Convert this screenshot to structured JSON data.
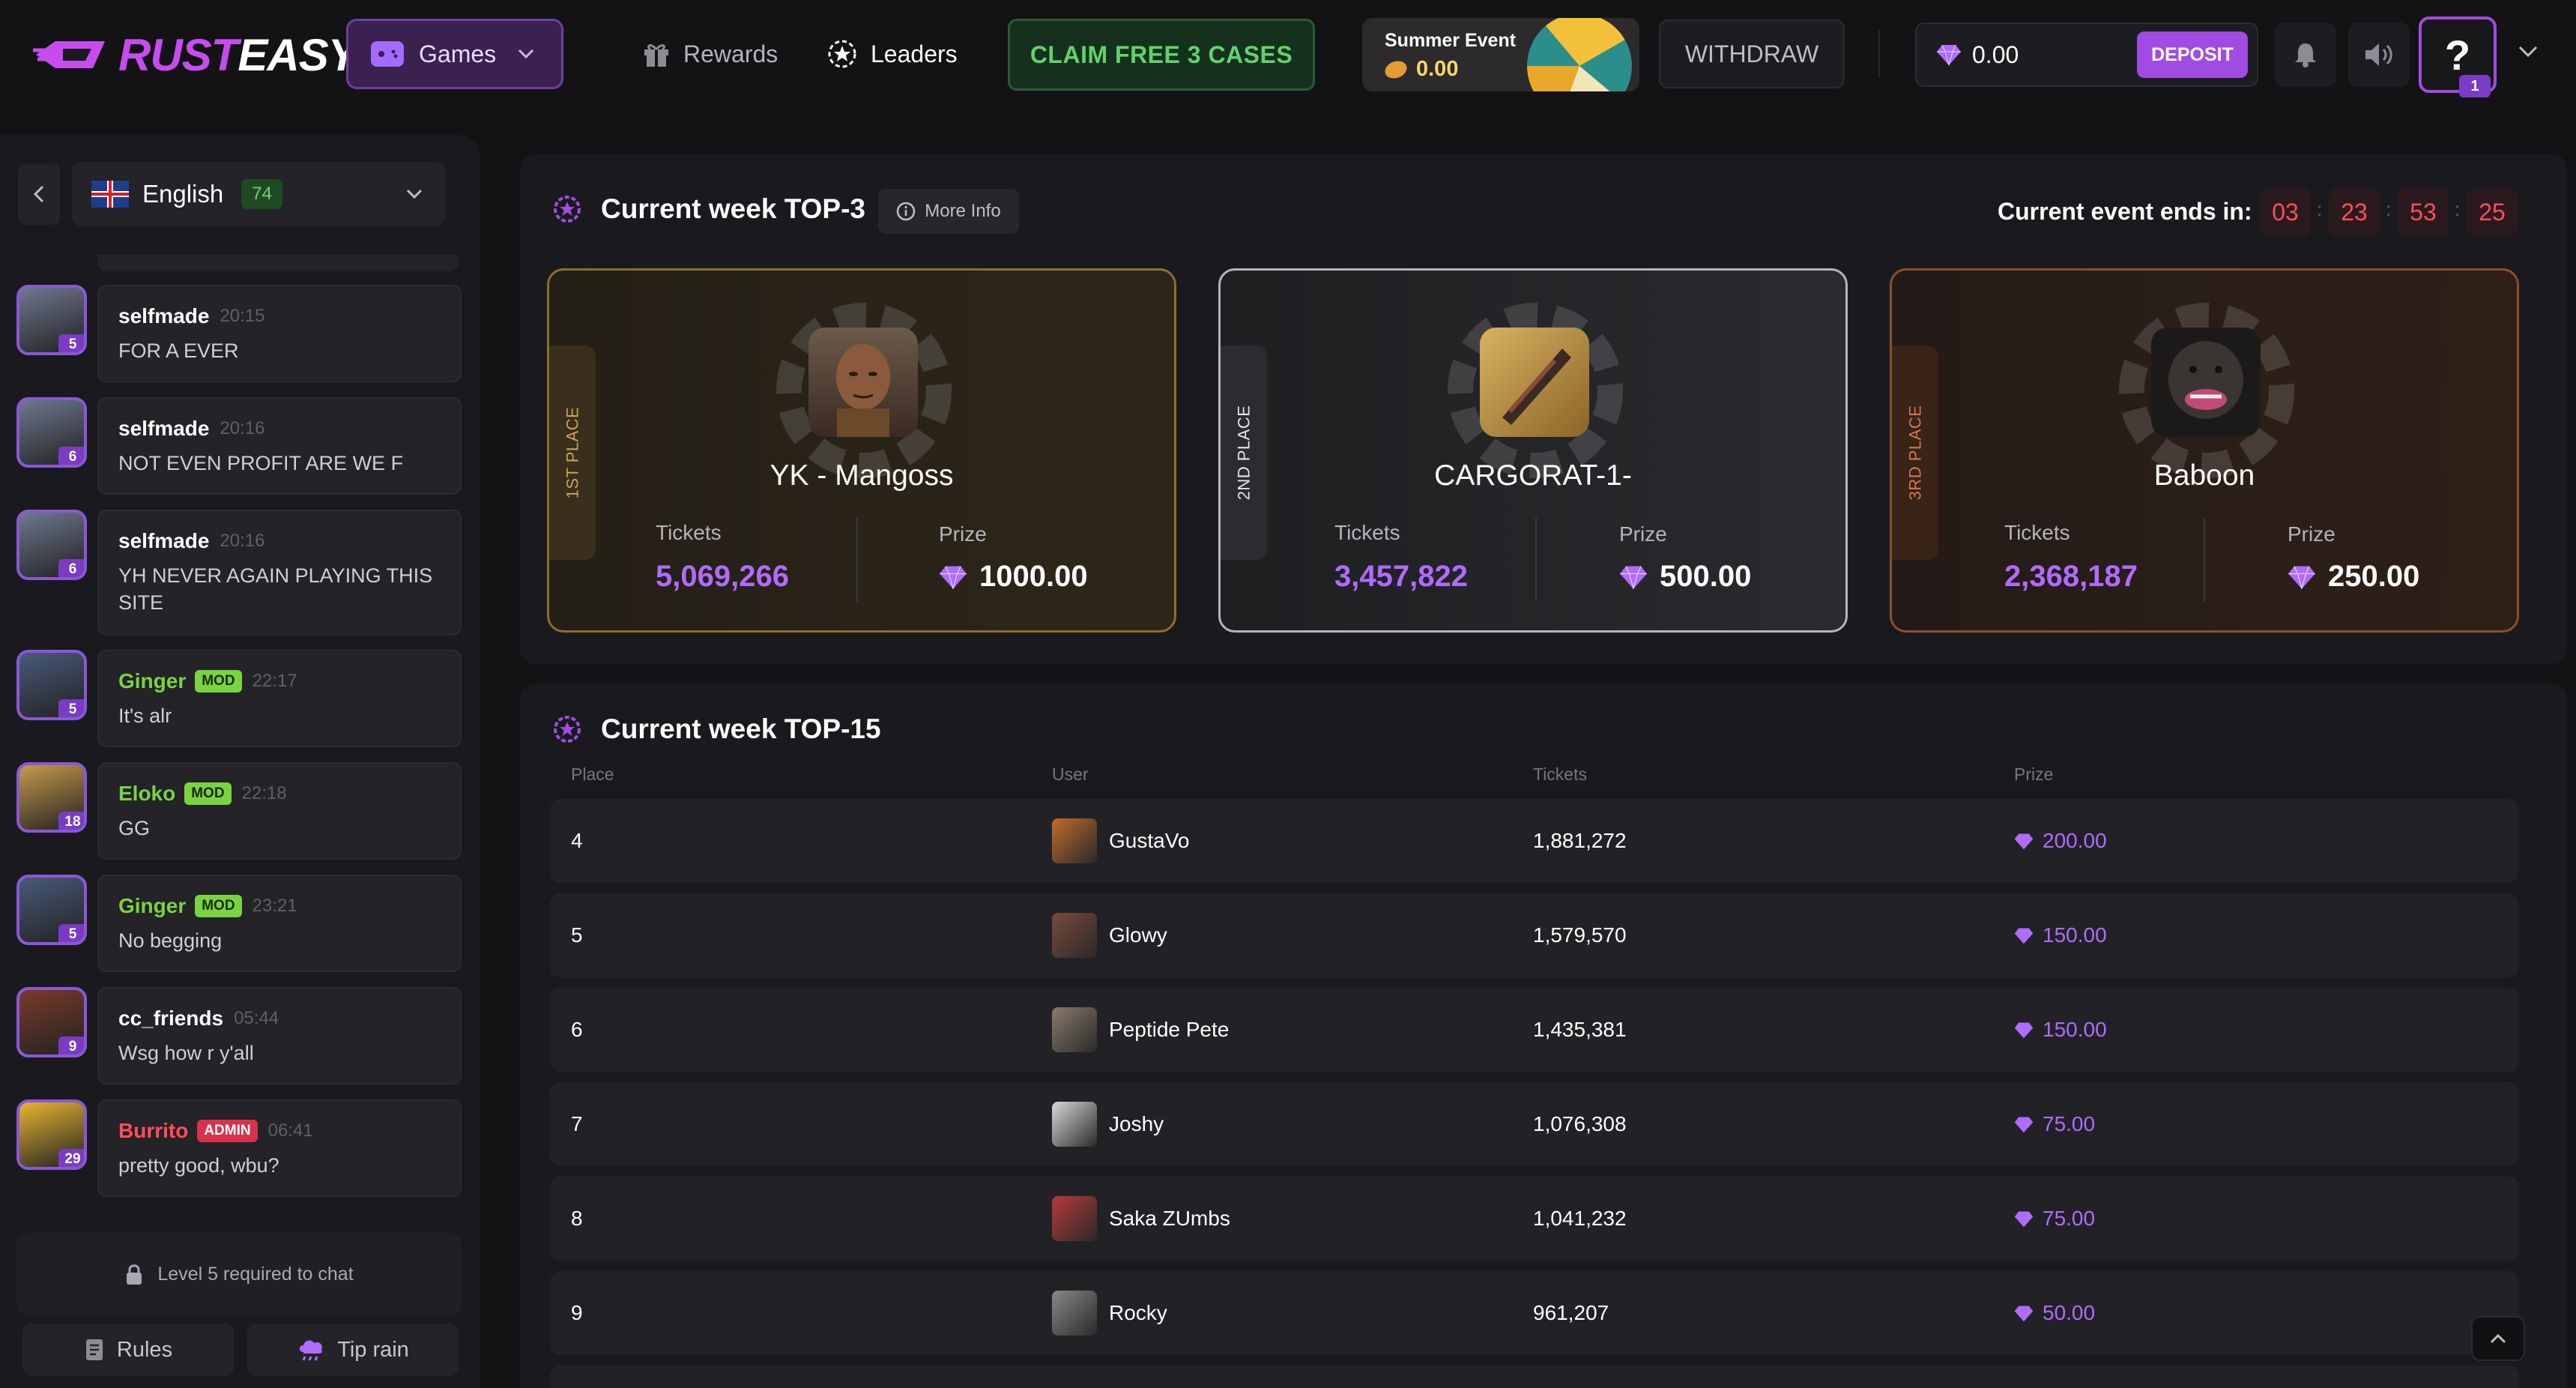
{
  "header": {
    "logo_part1": "RUST",
    "logo_part2": "EASY",
    "games_label": "Games",
    "nav": {
      "rewards": "Rewards",
      "leaders": "Leaders"
    },
    "claim_label": "CLAIM FREE 3 CASES",
    "event": {
      "title": "Summer Event",
      "value": "0.00"
    },
    "withdraw_label": "WITHDRAW",
    "balance": "0.00",
    "deposit_label": "DEPOSIT",
    "help_label": "?",
    "help_badge": "1"
  },
  "sidebar": {
    "language": "English",
    "online_count": "74",
    "messages": [
      {
        "user": "selfmade",
        "role": "",
        "time": "20:15",
        "text": "FOR A EVER",
        "level": "5",
        "color": "#ffffff"
      },
      {
        "user": "selfmade",
        "role": "",
        "time": "20:16",
        "text": "NOT EVEN PROFIT ARE WE F",
        "level": "6",
        "color": "#ffffff"
      },
      {
        "user": "selfmade",
        "role": "",
        "time": "20:16",
        "text": "YH NEVER AGAIN PLAYING THIS SITE",
        "level": "6",
        "color": "#ffffff"
      },
      {
        "user": "Ginger",
        "role": "MOD",
        "time": "22:17",
        "text": "It's alr",
        "level": "5",
        "color": "#7bd340"
      },
      {
        "user": "Eloko",
        "role": "MOD",
        "time": "22:18",
        "text": "GG",
        "level": "18",
        "color": "#7bd340"
      },
      {
        "user": "Ginger",
        "role": "MOD",
        "time": "23:21",
        "text": "No begging",
        "level": "5",
        "color": "#7bd340"
      },
      {
        "user": "cc_friends",
        "role": "",
        "time": "05:44",
        "text": "Wsg how r y'all",
        "level": "9",
        "color": "#ffffff"
      },
      {
        "user": "Burrito",
        "role": "ADMIN",
        "time": "06:41",
        "text": "pretty good, wbu?",
        "level": "29",
        "color": "#ff4d5c"
      }
    ],
    "chat_locked": "Level 5 required to chat",
    "rules_label": "Rules",
    "tip_rain_label": "Tip rain"
  },
  "top3": {
    "title": "Current week TOP-3",
    "more_info": "More Info",
    "ends_label": "Current event ends in:",
    "countdown": [
      "03",
      "23",
      "53",
      "25"
    ],
    "tickets_label": "Tickets",
    "prize_label": "Prize",
    "places": [
      {
        "place_label": "1ST PLACE",
        "name": "YK - Mangoss",
        "tickets": "5,069,266",
        "prize": "1000.00"
      },
      {
        "place_label": "2ND PLACE",
        "name": "CARGORAT-1-",
        "tickets": "3,457,822",
        "prize": "500.00"
      },
      {
        "place_label": "3RD PLACE",
        "name": "Baboon",
        "tickets": "2,368,187",
        "prize": "250.00"
      }
    ]
  },
  "top15": {
    "title": "Current week TOP-15",
    "columns": {
      "place": "Place",
      "user": "User",
      "tickets": "Tickets",
      "prize": "Prize"
    },
    "rows": [
      {
        "place": "4",
        "user": "GustaVo",
        "tickets": "1,881,272",
        "prize": "200.00"
      },
      {
        "place": "5",
        "user": "Glowy",
        "tickets": "1,579,570",
        "prize": "150.00"
      },
      {
        "place": "6",
        "user": "Peptide Pete",
        "tickets": "1,435,381",
        "prize": "150.00"
      },
      {
        "place": "7",
        "user": "Joshy",
        "tickets": "1,076,308",
        "prize": "75.00"
      },
      {
        "place": "8",
        "user": "Saka ZUmbs",
        "tickets": "1,041,232",
        "prize": "75.00"
      },
      {
        "place": "9",
        "user": "Rocky",
        "tickets": "961,207",
        "prize": "50.00"
      }
    ]
  },
  "colors": {
    "accent": "#a24be2",
    "gem": "#b06bff",
    "claim_green": "#5fd36a",
    "countdown_red": "#ff4d5c",
    "mod_green": "#7bd340",
    "admin_red": "#d8324a"
  }
}
